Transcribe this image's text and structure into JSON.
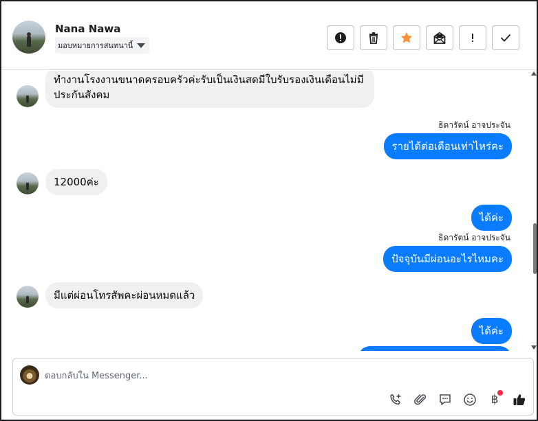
{
  "header": {
    "contact_name": "Nana Nawa",
    "assign_label": "มอบหมายการสนทนานี้",
    "actions": [
      {
        "icon": "alert-circle-icon"
      },
      {
        "icon": "trash-icon"
      },
      {
        "icon": "star-icon",
        "color": "#f7923b"
      },
      {
        "icon": "mark-unread-icon"
      },
      {
        "icon": "exclamation-icon"
      },
      {
        "icon": "check-icon"
      }
    ]
  },
  "messages": [
    {
      "from": "contact",
      "text_line1": "ทำงานโรงงานขนาดครอบครัวค่ะรับเป็นเงินสดมีใบรับรองเงินเดือนไม่มี",
      "text_line2": "ประกันสังคม"
    },
    {
      "from": "page",
      "sender": "ธิดารัตน์ อาจประจัน",
      "text": "รายได้ต่อเดือนเท่าไหร่คะ"
    },
    {
      "from": "contact",
      "text": "12000ค่ะ"
    },
    {
      "from": "page",
      "text": "ได้ค่ะ"
    },
    {
      "from": "page",
      "sender": "ธิดารัตน์ อาจประจัน",
      "text": "ปัจจุบันมีผ่อนอะไรไหมคะ"
    },
    {
      "from": "contact",
      "text": "มีแต่ผ่อนโทรสัพคะผ่อนหมดแล้ว"
    },
    {
      "from": "page",
      "text": "ได้ค่ะ"
    }
  ],
  "composer": {
    "placeholder": "ตอบกลับใน Messenger...",
    "baht_symbol": "฿",
    "colors": {
      "accent": "#0a7cff",
      "notification": "#f02849"
    }
  }
}
